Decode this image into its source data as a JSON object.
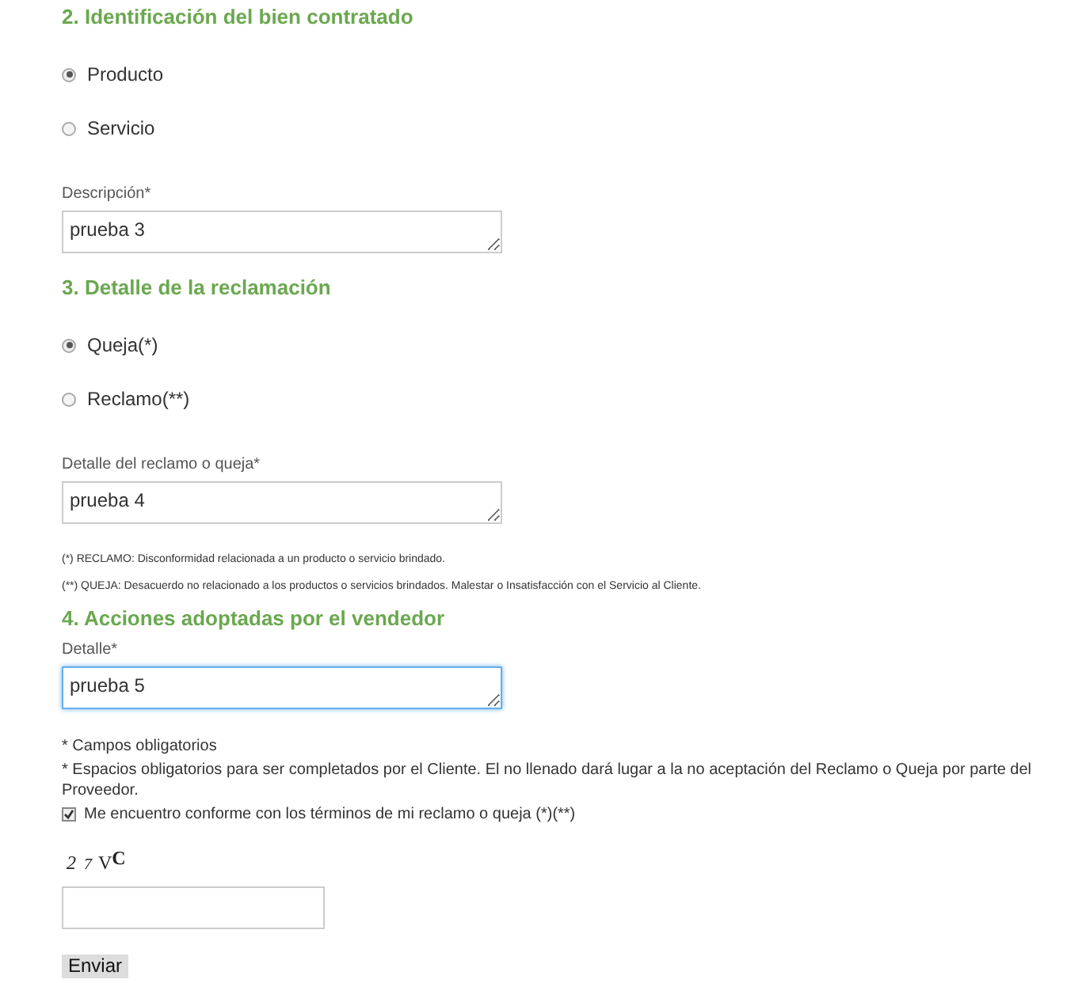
{
  "sections": [
    {
      "heading": "2. Identificación del bien contratado",
      "options": [
        {
          "label": "Producto",
          "selected": true
        },
        {
          "label": "Servicio",
          "selected": false
        }
      ],
      "field": {
        "label": "Descripción*",
        "value": "prueba 3",
        "focused": false
      }
    },
    {
      "heading": "3. Detalle de la reclamación",
      "options": [
        {
          "label": "Queja(*)",
          "selected": true
        },
        {
          "label": "Reclamo(**)",
          "selected": false
        }
      ],
      "field": {
        "label": "Detalle del reclamo o queja*",
        "value": "prueba 4",
        "focused": false
      },
      "notes": [
        "(*) RECLAMO: Disconformidad relacionada a un producto o servicio brindado.",
        "(**) QUEJA: Desacuerdo no relacionado a los productos o servicios brindados. Malestar o Insatisfacción con el Servicio al Cliente."
      ]
    },
    {
      "heading": "4. Acciones adoptadas por el vendedor",
      "field": {
        "label": "Detalle*",
        "value": "prueba 5",
        "focused": true
      }
    }
  ],
  "footnotes": [
    "* Campos obligatorios",
    "* Espacios obligatorios para ser completados por el Cliente. El no llenado dará lugar a la no aceptación del Reclamo o Queja por parte del Proveedor."
  ],
  "agreement": {
    "label": "Me encuentro conforme con los términos de mi reclamo o queja (*)(**)",
    "checked": true
  },
  "captcha": {
    "characters": [
      "2",
      "7",
      "V",
      "C"
    ]
  },
  "submit": "Enviar"
}
